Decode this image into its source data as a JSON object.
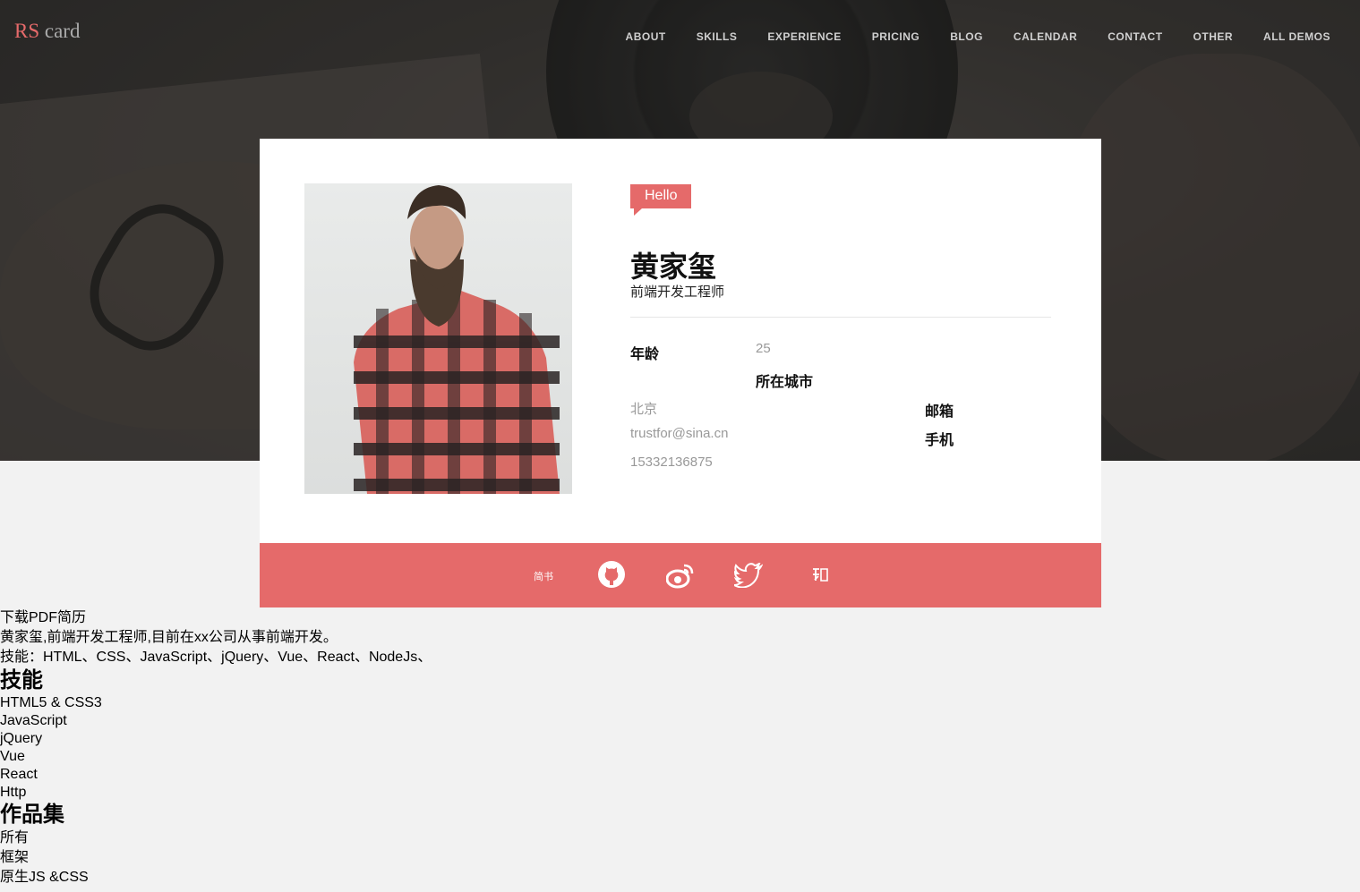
{
  "header": {
    "logo_primary": "RS",
    "logo_secondary": "card",
    "nav": [
      "ABOUT",
      "SKILLS",
      "EXPERIENCE",
      "PRICING",
      "BLOG",
      "CALENDAR",
      "CONTACT",
      "OTHER",
      "ALL DEMOS"
    ]
  },
  "profile": {
    "greeting": "Hello",
    "name": "黄家玺",
    "title": "前端开发工程师",
    "age_label": "年龄",
    "age_value": "25",
    "city_label": "所在城市",
    "city_value": "北京",
    "email_label": "邮箱",
    "email_value": "trustfor@sina.cn",
    "phone_label": "手机",
    "phone_value": "15332136875"
  },
  "social": {
    "jianshu_label": "简书",
    "icons": [
      "github-icon",
      "weibo-icon",
      "twitter-icon",
      "zhihu-icon"
    ]
  },
  "about": {
    "download": "下载PDF简历",
    "intro": "黄家玺,前端开发工程师,目前在xx公司从事前端开发。",
    "skills_line": "技能：HTML、CSS、JavaScript、jQuery、Vue、React、NodeJs、"
  },
  "skills": {
    "heading": "技能",
    "items": [
      "HTML5 & CSS3",
      "JavaScript",
      "jQuery",
      "Vue",
      "React",
      "Http"
    ]
  },
  "portfolio": {
    "heading": "作品集",
    "filters": [
      "所有",
      "框架",
      "原生JS &CSS"
    ]
  },
  "colors": {
    "accent": "#e56a6a",
    "page_bg": "#f2f2f2",
    "hero_bg": "#3a3735"
  }
}
